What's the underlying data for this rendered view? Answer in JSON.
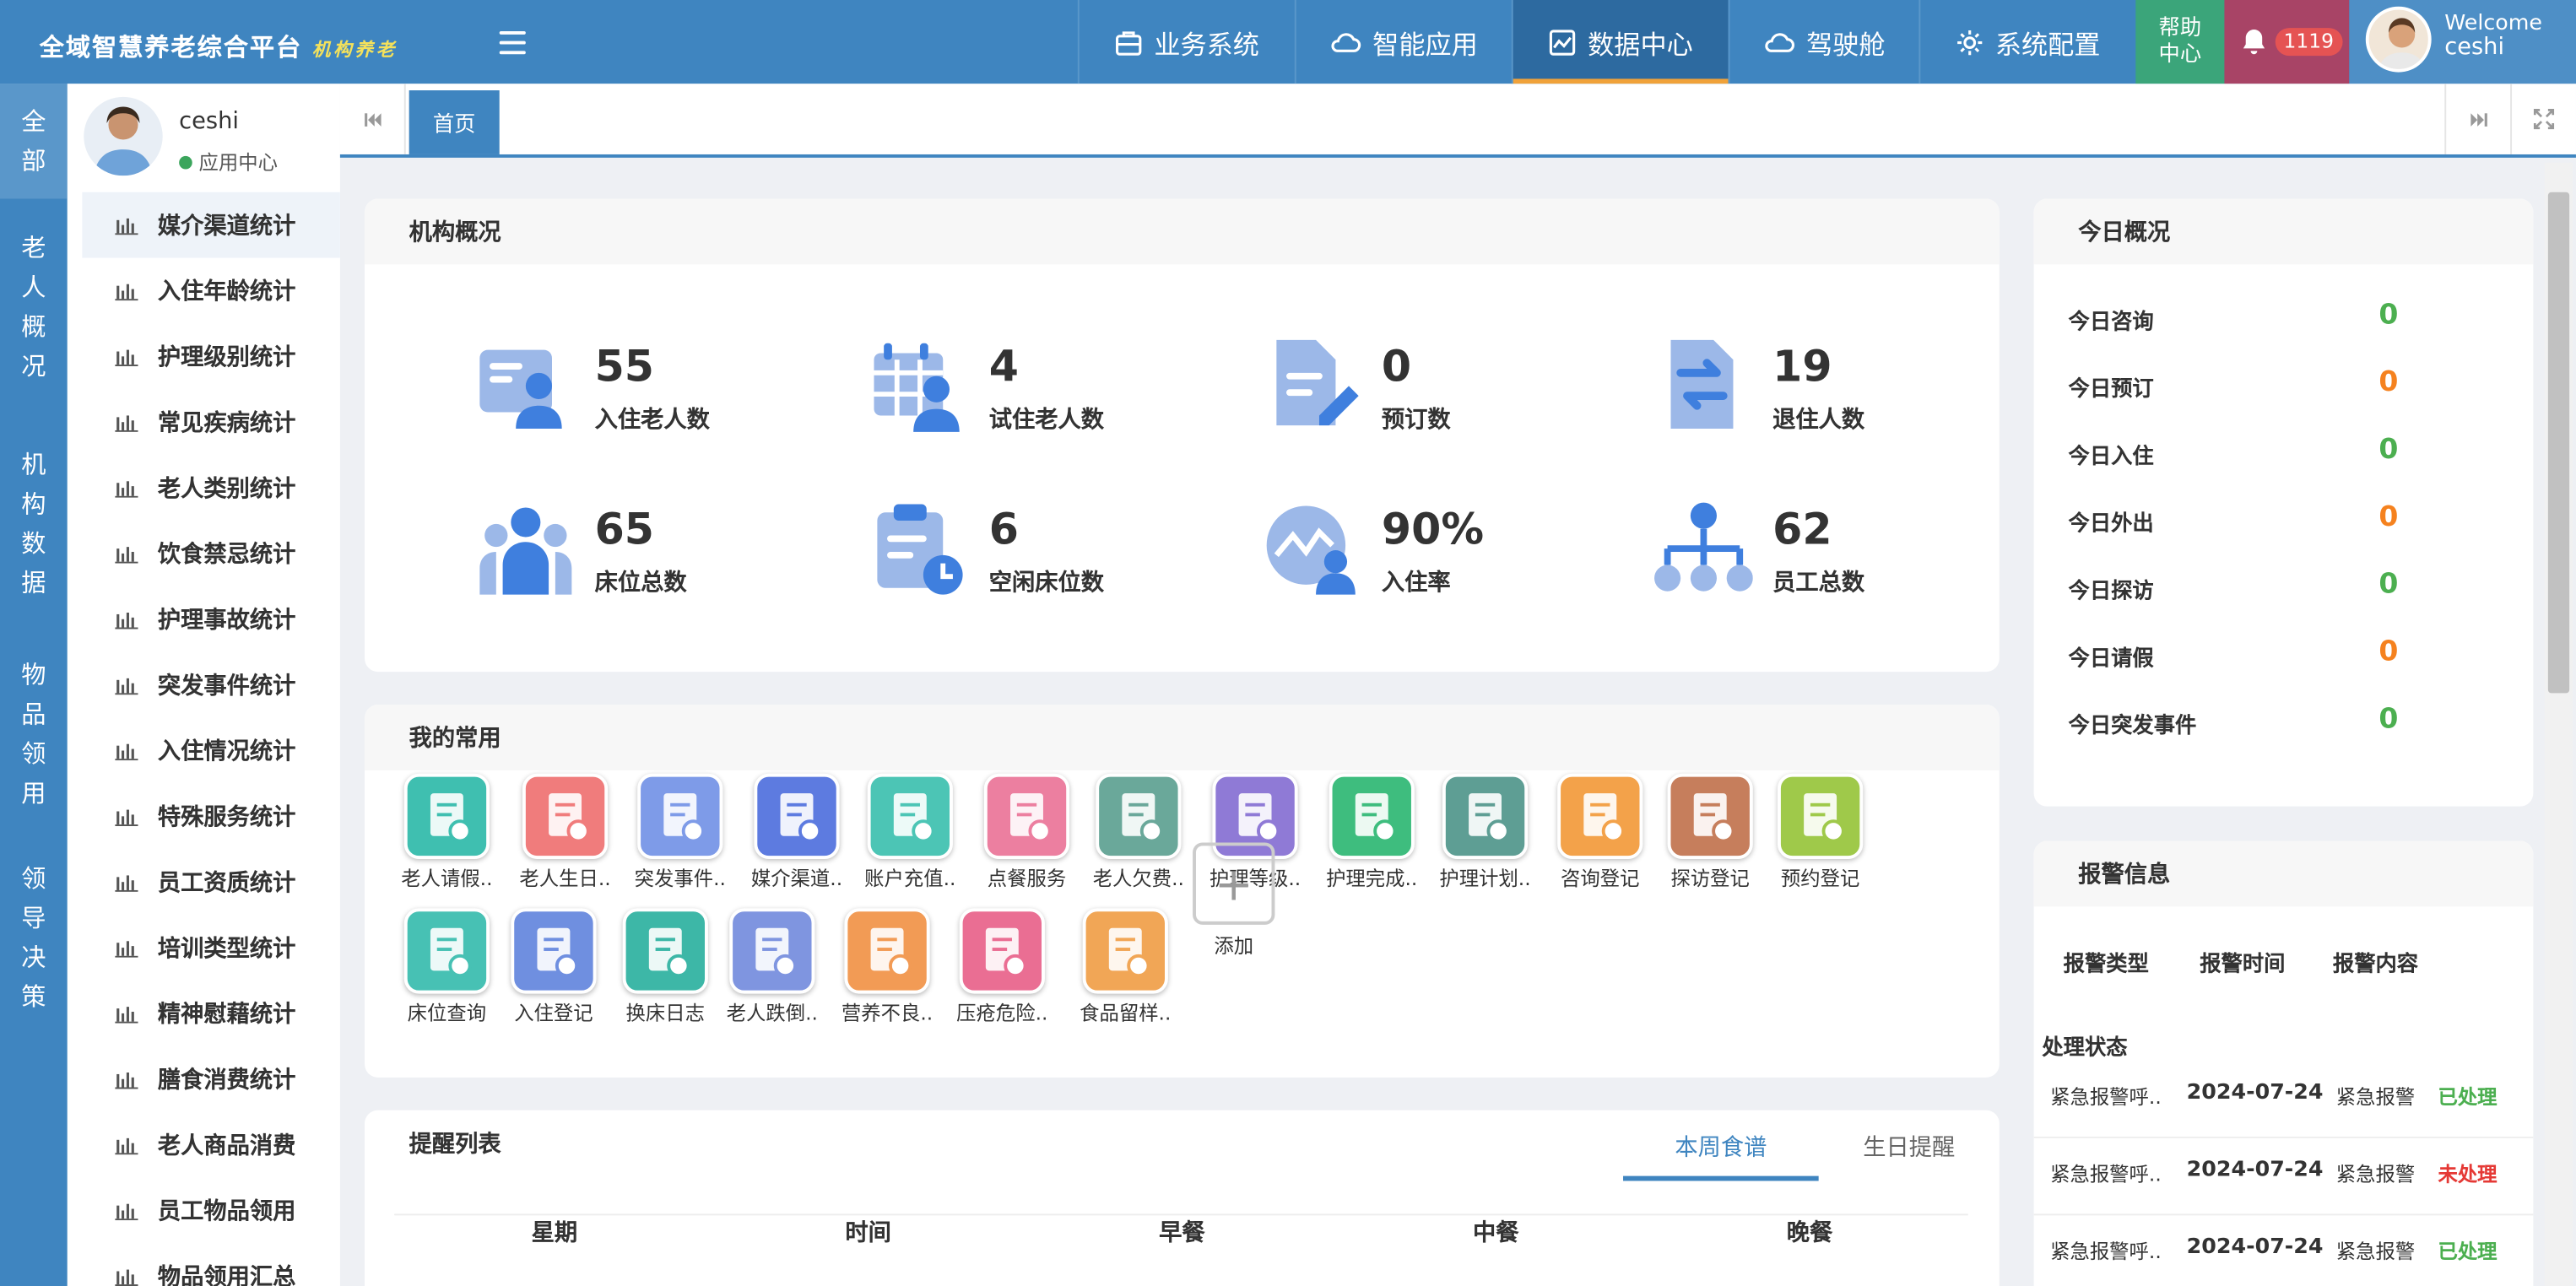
{
  "header": {
    "brand": "全域智慧养老综合平台",
    "brand_sub": "机构养老",
    "nav": [
      {
        "label": "业务系统",
        "icon": "briefcase-icon"
      },
      {
        "label": "智能应用",
        "icon": "cloud-icon"
      },
      {
        "label": "数据中心",
        "icon": "chart-icon",
        "active": true
      },
      {
        "label": "驾驶舱",
        "icon": "cloud-icon"
      },
      {
        "label": "系统配置",
        "icon": "gear-icon"
      }
    ],
    "help": "帮助\n中心",
    "notifications": "1119",
    "welcome": "Welcome",
    "username": "ceshi"
  },
  "strip": [
    {
      "label": "全部",
      "active": true
    },
    {
      "label": "老人概况"
    },
    {
      "label": "机构数据"
    },
    {
      "label": "物品领用"
    },
    {
      "label": "领导决策"
    }
  ],
  "profile": {
    "name": "ceshi",
    "status": "应用中心"
  },
  "menu": [
    "媒介渠道统计",
    "入住年龄统计",
    "护理级别统计",
    "常见疾病统计",
    "老人类别统计",
    "饮食禁忌统计",
    "护理事故统计",
    "突发事件统计",
    "入住情况统计",
    "特殊服务统计",
    "员工资质统计",
    "培训类型统计",
    "精神慰藉统计",
    "膳食消费统计",
    "老人商品消费",
    "员工物品领用",
    "物品领用汇总"
  ],
  "tabs": {
    "home": "首页"
  },
  "overview": {
    "title": "机构概况",
    "stats": [
      {
        "value": "55",
        "label": "入住老人数",
        "icon": "elder-card-icon"
      },
      {
        "value": "4",
        "label": "试住老人数",
        "icon": "calendar-person-icon"
      },
      {
        "value": "0",
        "label": "预订数",
        "icon": "edit-document-icon"
      },
      {
        "value": "19",
        "label": "退住人数",
        "icon": "exchange-icon"
      },
      {
        "value": "65",
        "label": "床位总数",
        "icon": "group-icon"
      },
      {
        "value": "6",
        "label": "空闲床位数",
        "icon": "clipboard-clock-icon"
      },
      {
        "value": "90%",
        "label": "入住率",
        "icon": "trend-person-icon"
      },
      {
        "value": "62",
        "label": "员工总数",
        "icon": "org-chart-icon"
      }
    ]
  },
  "favorites": {
    "title": "我的常用",
    "items": [
      {
        "label": "老人请假..",
        "color": "#3fbfb0"
      },
      {
        "label": "老人生日..",
        "color": "#f07c7c"
      },
      {
        "label": "突发事件..",
        "color": "#7e9be8"
      },
      {
        "label": "媒介渠道..",
        "color": "#5d7be0"
      },
      {
        "label": "账户充值..",
        "color": "#4cc5b5"
      },
      {
        "label": "点餐服务",
        "color": "#ec7fa0"
      },
      {
        "label": "老人欠费..",
        "color": "#6aa89a"
      },
      {
        "label": "护理等级..",
        "color": "#8f7ad6"
      },
      {
        "label": "护理完成..",
        "color": "#3ebd7e"
      },
      {
        "label": "护理计划..",
        "color": "#5e9e94"
      },
      {
        "label": "咨询登记",
        "color": "#f3a24a"
      },
      {
        "label": "探访登记",
        "color": "#c67e5c"
      },
      {
        "label": "预约登记",
        "color": "#9fc94a"
      },
      {
        "label": "床位查询",
        "color": "#47c1b4"
      },
      {
        "label": "入住登记",
        "color": "#6f8fe0"
      },
      {
        "label": "换床日志",
        "color": "#3db7a7"
      },
      {
        "label": "老人跌倒..",
        "color": "#7f95e0"
      },
      {
        "label": "营养不良..",
        "color": "#f29b55"
      },
      {
        "label": "压疮危险..",
        "color": "#ea6e93"
      },
      {
        "label": "食品留样..",
        "color": "#f1a656"
      }
    ],
    "add_label": "添加"
  },
  "reminders": {
    "title": "提醒列表",
    "tabs": [
      "本周食谱",
      "生日提醒"
    ],
    "columns": [
      "星期",
      "时间",
      "早餐",
      "中餐",
      "晚餐"
    ]
  },
  "today": {
    "title": "今日概况",
    "items": [
      {
        "label": "今日咨询",
        "value": "0",
        "color": "#4caf50"
      },
      {
        "label": "今日预订",
        "value": "0",
        "color": "#f5821f"
      },
      {
        "label": "今日入住",
        "value": "0",
        "color": "#4caf50"
      },
      {
        "label": "今日外出",
        "value": "0",
        "color": "#f5821f"
      },
      {
        "label": "今日探访",
        "value": "0",
        "color": "#4caf50"
      },
      {
        "label": "今日请假",
        "value": "0",
        "color": "#f5821f"
      },
      {
        "label": "今日突发事件",
        "value": "0",
        "color": "#4caf50"
      }
    ]
  },
  "alarms": {
    "title": "报警信息",
    "columns": [
      "报警类型",
      "报警时间",
      "报警内容",
      "处理状态"
    ],
    "rows": [
      {
        "type": "紧急报警呼..",
        "time": "2024-07-24",
        "content": "紧急报警",
        "status": "已处理",
        "status_color": "#4caf50"
      },
      {
        "type": "紧急报警呼..",
        "time": "2024-07-24",
        "content": "紧急报警",
        "status": "未处理",
        "status_color": "#e53935"
      },
      {
        "type": "紧急报警呼..",
        "time": "2024-07-24",
        "content": "紧急报警",
        "status": "已处理",
        "status_color": "#4caf50"
      }
    ]
  }
}
